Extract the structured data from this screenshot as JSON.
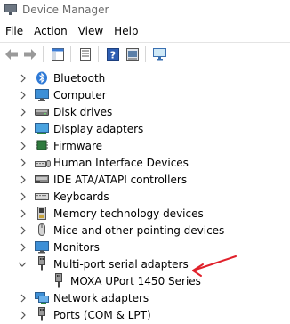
{
  "window": {
    "title": "Device Manager"
  },
  "menu": [
    "File",
    "Action",
    "View",
    "Help"
  ],
  "toolbar": {
    "buttons": [
      "back-icon",
      "forward-icon",
      "show-hide-console-tree-icon",
      "properties-icon",
      "help-icon",
      "update-driver-icon",
      "scan-for-hardware-changes-icon"
    ]
  },
  "tree": {
    "items": [
      {
        "label": "Bluetooth",
        "icon": "bluetooth-icon",
        "state": "collapsed"
      },
      {
        "label": "Computer",
        "icon": "computer-icon",
        "state": "collapsed"
      },
      {
        "label": "Disk drives",
        "icon": "disk-drive-icon",
        "state": "collapsed"
      },
      {
        "label": "Display adapters",
        "icon": "display-adapter-icon",
        "state": "collapsed"
      },
      {
        "label": "Firmware",
        "icon": "firmware-icon",
        "state": "collapsed"
      },
      {
        "label": "Human Interface Devices",
        "icon": "hid-icon",
        "state": "collapsed"
      },
      {
        "label": "IDE ATA/ATAPI controllers",
        "icon": "ide-controller-icon",
        "state": "collapsed"
      },
      {
        "label": "Keyboards",
        "icon": "keyboard-icon",
        "state": "collapsed"
      },
      {
        "label": "Memory technology devices",
        "icon": "memory-device-icon",
        "state": "collapsed"
      },
      {
        "label": "Mice and other pointing devices",
        "icon": "mouse-icon",
        "state": "collapsed"
      },
      {
        "label": "Monitors",
        "icon": "monitor-icon",
        "state": "collapsed"
      },
      {
        "label": "Multi-port serial adapters",
        "icon": "serial-adapter-icon",
        "state": "expanded",
        "children": [
          {
            "label": "MOXA UPort 1450 Series",
            "icon": "serial-adapter-icon"
          }
        ]
      },
      {
        "label": "Network adapters",
        "icon": "network-adapter-icon",
        "state": "collapsed"
      },
      {
        "label": "Ports (COM & LPT)",
        "icon": "port-icon",
        "state": "collapsed"
      }
    ]
  },
  "annotation": {
    "icon": "red-arrow-icon",
    "color": "#e0202a"
  }
}
